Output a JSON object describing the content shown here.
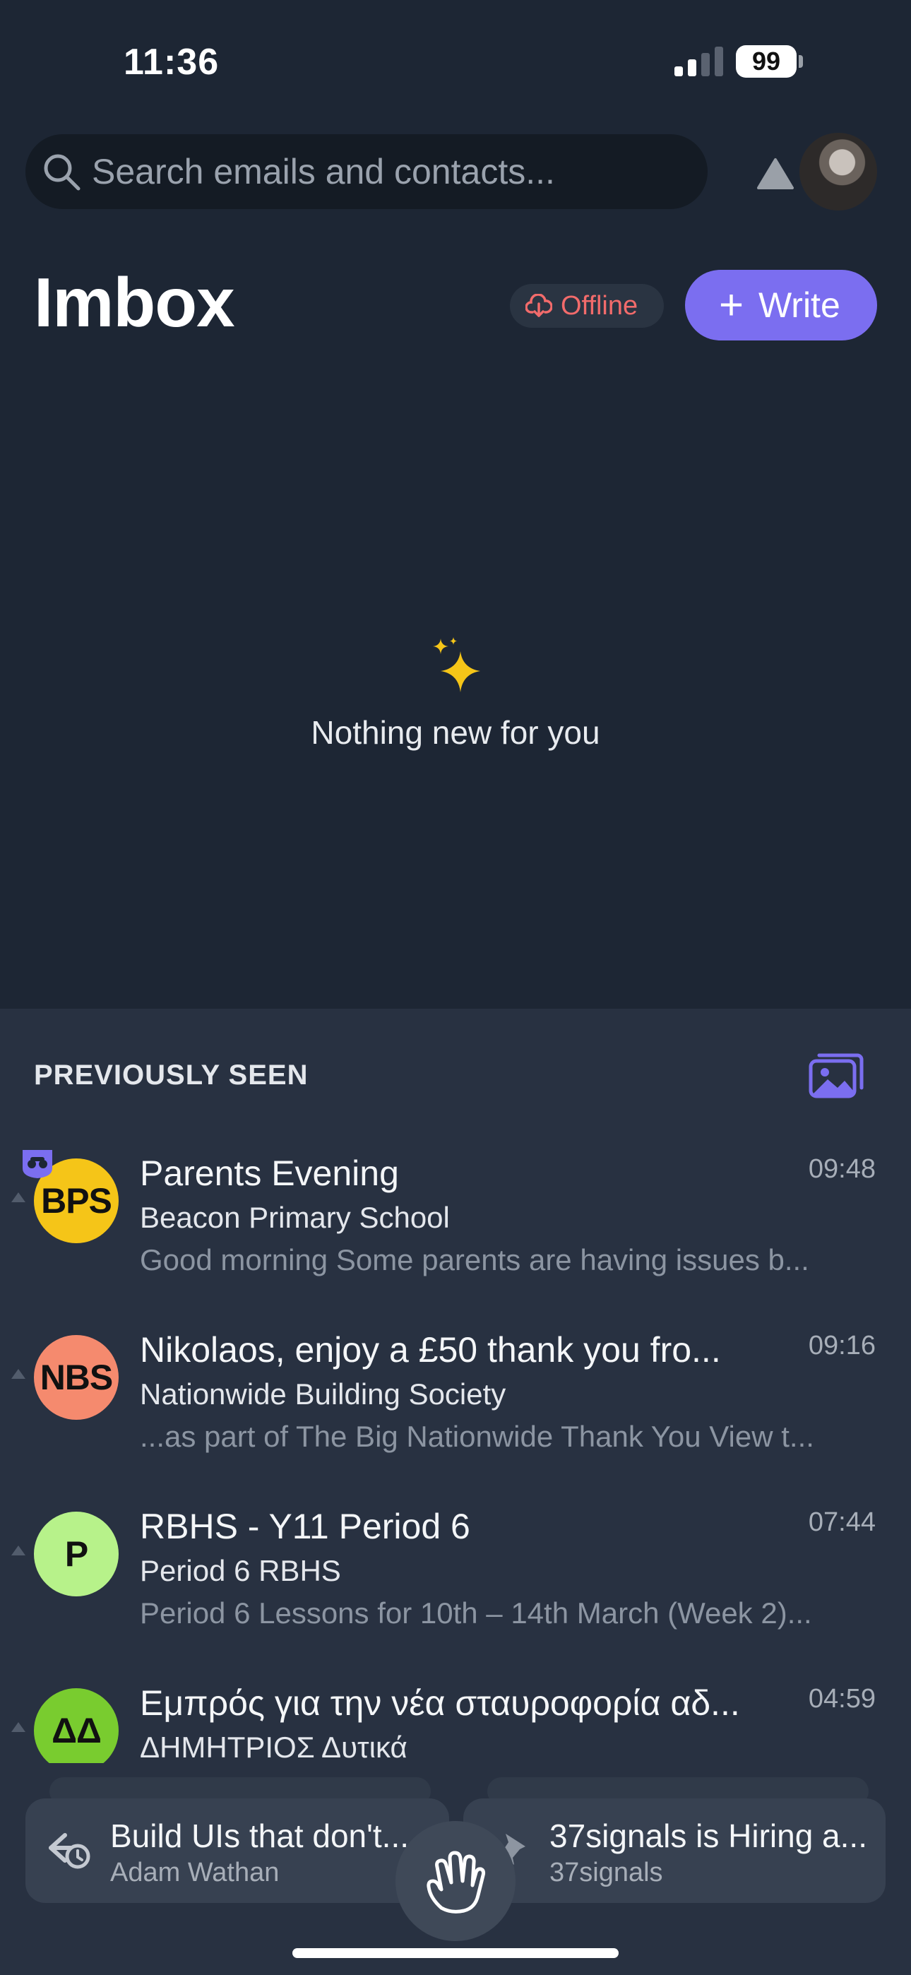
{
  "status_bar": {
    "time": "11:36",
    "battery": "99"
  },
  "search": {
    "placeholder": "Search emails and contacts..."
  },
  "header": {
    "title": "Imbox",
    "offline_label": "Offline",
    "write_label": "Write"
  },
  "empty_state": {
    "message": "Nothing new for you"
  },
  "previously_seen": {
    "heading": "PREVIOUSLY SEEN",
    "emails": [
      {
        "badge": "BPS",
        "badge_color": "#f5c518",
        "subject": "Parents Evening",
        "time": "09:48",
        "sender": "Beacon Primary School",
        "preview": "Good morning Some parents are having issues b..."
      },
      {
        "badge": "NBS",
        "badge_color": "#f58a6e",
        "subject": "Nikolaos, enjoy a £50 thank you fro...",
        "time": "09:16",
        "sender": "Nationwide Building Society",
        "preview": "...as part of The Big Nationwide Thank You View t..."
      },
      {
        "badge": "P",
        "badge_color": "#b7f28a",
        "subject": "RBHS - Y11 Period 6",
        "time": "07:44",
        "sender": "Period 6 RBHS",
        "preview": "Period 6 Lessons for 10th – 14th March (Week 2)..."
      },
      {
        "badge": "ΔΔ",
        "badge_color": "#79cc2f",
        "subject": "Εμπρός για την νέα σταυροφορία αδ...",
        "time": "04:59",
        "sender": "ΔΗΜΗΤΡΙΟΣ Δυτικά",
        "preview": ""
      }
    ]
  },
  "bottom_cards": [
    {
      "title": "Build UIs that don't...",
      "subtitle": "Adam Wathan",
      "icon": "reply-later-icon"
    },
    {
      "title": "37signals is Hiring a...",
      "subtitle": "37signals",
      "icon": "pin-icon"
    }
  ],
  "colors": {
    "background": "#1d2634",
    "panel": "#283141",
    "accent": "#7b6ef0",
    "offline": "#f26b6b"
  }
}
